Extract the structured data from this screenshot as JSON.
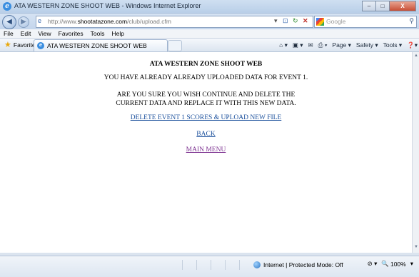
{
  "window": {
    "title": "ATA WESTERN ZONE SHOOT WEB - Windows Internet Explorer",
    "minimize": "–",
    "maximize": "□",
    "close": "X"
  },
  "address": {
    "url_prefix": "http://www.",
    "url_domain": "shootatazone.com",
    "url_path": "/club/upload.cfm",
    "search_placeholder": "Google"
  },
  "menu": {
    "items": [
      "File",
      "Edit",
      "View",
      "Favorites",
      "Tools",
      "Help"
    ]
  },
  "tabs": {
    "favorites_label": "Favorites",
    "active_tab": "ATA WESTERN ZONE SHOOT WEB"
  },
  "commands": {
    "page": "Page",
    "safety": "Safety",
    "tools": "Tools"
  },
  "page": {
    "heading": "ATA WESTERN ZONE SHOOT WEB",
    "message1": "YOU HAVE ALREADY ALREADY UPLOADED DATA FOR EVENT 1.",
    "message2_line1": "ARE YOU SURE YOU WISH CONTINUE AND DELETE THE",
    "message2_line2": "CURRENT DATA AND REPLACE IT WITH THIS NEW DATA.",
    "link_delete": "DELETE EVENT 1 SCORES & UPLOAD NEW FILE",
    "link_back": "BACK",
    "link_main": "MAIN MENU"
  },
  "status": {
    "zone": "Internet | Protected Mode: Off",
    "zoom": "100%"
  },
  "colors": {
    "link": "#1a4f9c",
    "visited_link": "#7b2f8f"
  }
}
